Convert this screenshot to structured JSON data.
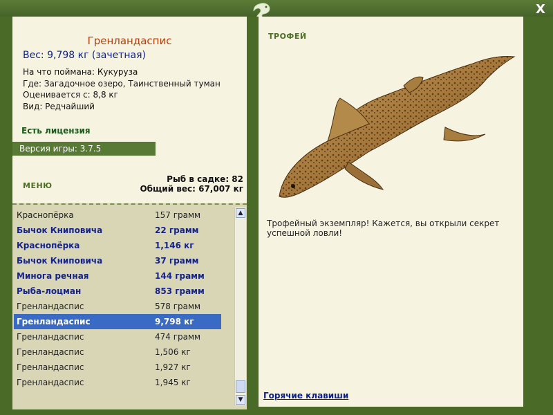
{
  "close_label": "X",
  "fish": {
    "name": "Гренландаспис",
    "weight": "Вес: 9,798 кг (зачетная)",
    "bait": "На что поймана: Кукуруза",
    "place": "Где: Загадочное озеро, Таинственный туман",
    "value": "Оценивается с: 8,8 кг",
    "kind": "Вид: Редчайший"
  },
  "license": "Есть лицензия",
  "version": "Версия игры: 3.7.5",
  "menu_label": "МЕНЮ",
  "stats": {
    "count": "Рыб в садке: 82",
    "total": "Общий вес: 67,007 кг"
  },
  "catches": [
    {
      "name": "Краснопёрка",
      "weight": "157 грамм",
      "trophy": false,
      "selected": false
    },
    {
      "name": "Бычок Книповича",
      "weight": "22 грамм",
      "trophy": true,
      "selected": false
    },
    {
      "name": "Краснопёрка",
      "weight": "1,146 кг",
      "trophy": true,
      "selected": false
    },
    {
      "name": "Бычок Книповича",
      "weight": "37 грамм",
      "trophy": true,
      "selected": false
    },
    {
      "name": "Минога речная",
      "weight": "144 грамм",
      "trophy": true,
      "selected": false
    },
    {
      "name": "Рыба-лоцман",
      "weight": "853 грамм",
      "trophy": true,
      "selected": false
    },
    {
      "name": "Гренландаспис",
      "weight": "578 грамм",
      "trophy": false,
      "selected": false
    },
    {
      "name": "Гренландаспис",
      "weight": "9,798 кг",
      "trophy": true,
      "selected": true
    },
    {
      "name": "Гренландаспис",
      "weight": "474 грамм",
      "trophy": false,
      "selected": false
    },
    {
      "name": "Гренландаспис",
      "weight": "1,506 кг",
      "trophy": false,
      "selected": false
    },
    {
      "name": "Гренландаспис",
      "weight": "1,927 кг",
      "trophy": false,
      "selected": false
    },
    {
      "name": "Гренландаспис",
      "weight": "1,945 кг",
      "trophy": false,
      "selected": false
    }
  ],
  "trophy_label": "ТРОФЕЙ",
  "description": "Трофейный экземпляр! Кажется, вы открыли секрет успешной ловли!",
  "hotkeys": "Горячие клавиши",
  "colors": {
    "frame": "#4a6a28",
    "panel": "#f6f3e0",
    "list_bg": "#d9d6b6",
    "trophy_text": "#15238c",
    "selected_row": "#3a6bc4",
    "fish_name": "#b5400c"
  },
  "icons": {
    "logo": "fish-logo-icon",
    "close": "close-icon",
    "scroll_up": "chevron-up-icon",
    "scroll_down": "chevron-down-icon"
  }
}
